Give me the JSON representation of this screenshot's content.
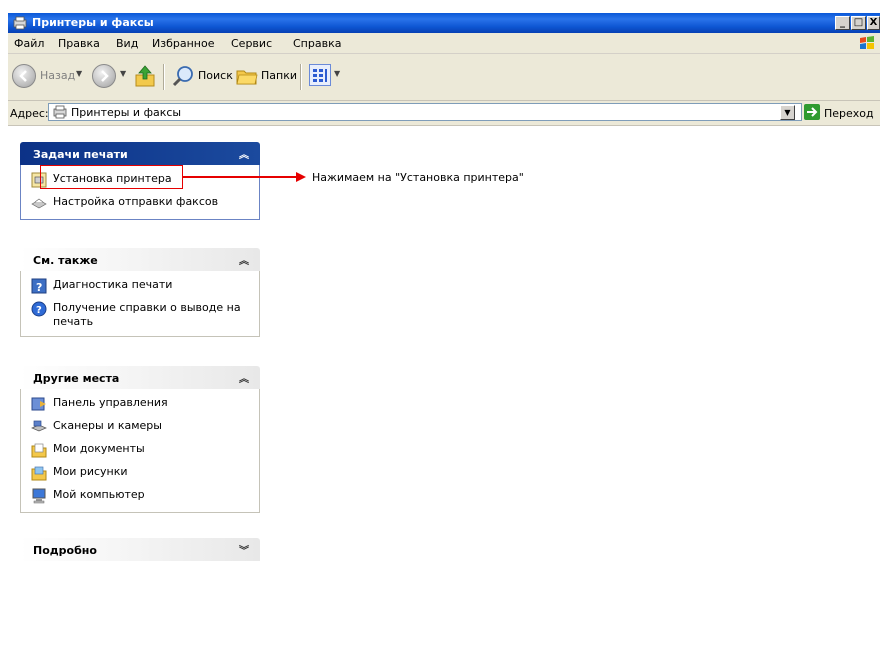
{
  "window": {
    "title": "Принтеры и факсы",
    "minimize": "_",
    "maximize": "□",
    "close": "X"
  },
  "menu": {
    "items": [
      "Файл",
      "Правка",
      "Вид",
      "Избранное",
      "Сервис",
      "Справка"
    ]
  },
  "toolbar": {
    "back_label": "Назад",
    "search_label": "Поиск",
    "folders_label": "Папки"
  },
  "address": {
    "label": "Адрес:",
    "value": "Принтеры и факсы",
    "go_label": "Переход"
  },
  "panels": {
    "print_tasks": {
      "title": "Задачи печати",
      "items": [
        "Установка принтера",
        "Настройка отправки факсов"
      ]
    },
    "see_also": {
      "title": "См. также",
      "items": [
        "Диагностика печати",
        "Получение справки о выводе на печать"
      ]
    },
    "other_places": {
      "title": "Другие места",
      "items": [
        "Панель управления",
        "Сканеры и камеры",
        "Мои документы",
        "Мои рисунки",
        "Мой компьютер"
      ]
    },
    "details": {
      "title": "Подробно"
    }
  },
  "annotation": {
    "text": "Нажимаем на \"Установка принтера\""
  },
  "colors": {
    "titlebar": "#0a58d8",
    "highlight": "#e60000",
    "primary_panel_header": "#0c3287"
  }
}
